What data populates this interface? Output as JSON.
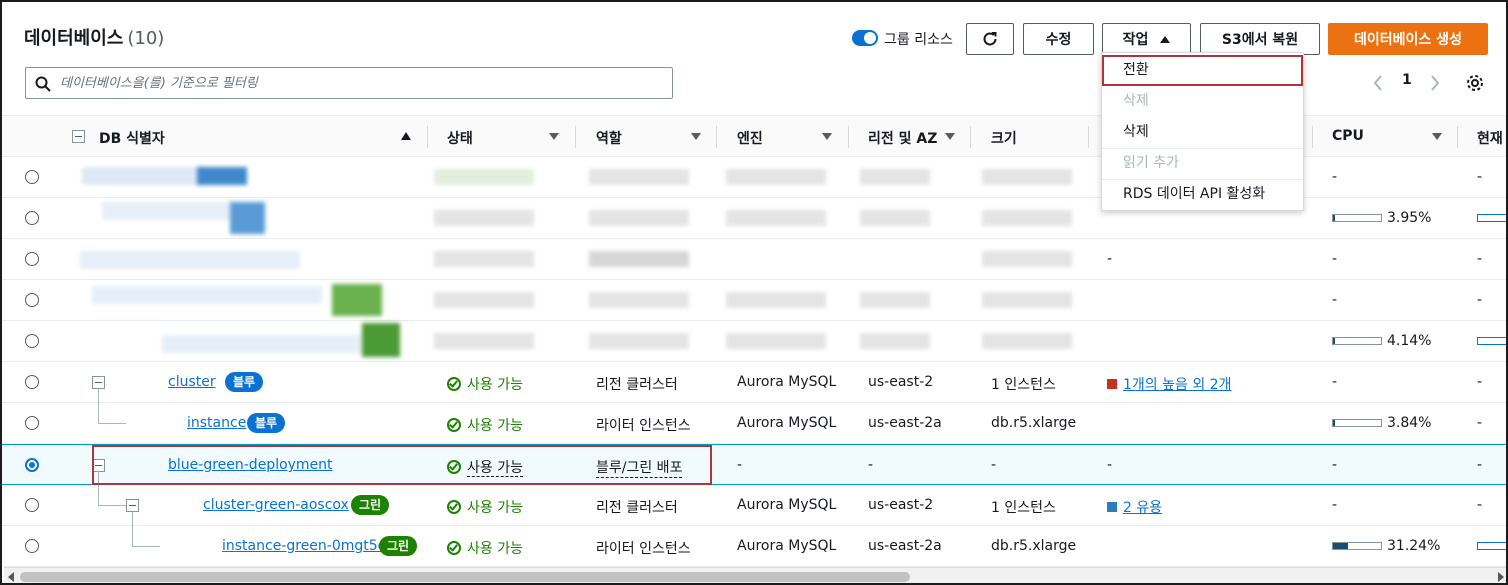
{
  "header": {
    "title": "데이터베이스",
    "count": "(10)",
    "group_toggle_label": "그룹 리소스",
    "modify_label": "수정",
    "actions_label": "작업",
    "restore_s3_label": "S3에서 복원",
    "create_db_label": "데이터베이스 생성"
  },
  "search": {
    "placeholder": "데이터베이스을(를) 기준으로 필터링"
  },
  "pager": {
    "page": "1"
  },
  "columns": {
    "db_id": "DB 식별자",
    "status": "상태",
    "role": "역할",
    "engine": "엔진",
    "region": "리전 및 AZ",
    "size": "크기",
    "cpu": "CPU",
    "current": "현재"
  },
  "actions_menu": {
    "items": [
      {
        "label": "전환",
        "disabled": false,
        "highlighted": true
      },
      {
        "label": "삭제",
        "disabled": true
      },
      {
        "label": "삭제",
        "disabled": false
      },
      {
        "label": "읽기 추가",
        "disabled": true
      },
      {
        "label": "RDS 데이터 API 활성화",
        "disabled": false
      }
    ]
  },
  "blurred_rows": {
    "r0": {
      "col8": "-",
      "col9": "-"
    },
    "r1": {
      "cpu": "3.95%",
      "cpu_value": 3.95
    },
    "r2": {
      "col7": "-",
      "col8": "-",
      "col9": "-"
    },
    "r3": {
      "col8": "-",
      "col9": "-"
    },
    "r4": {
      "cpu": "4.14%",
      "cpu_value": 4.14
    }
  },
  "rows": [
    {
      "id": "cluster",
      "badge": "블루",
      "status": "사용 가능",
      "role": "리전 클러스터",
      "engine": "Aurora MySQL",
      "region": "us-east-2",
      "size": "1 인스턴스",
      "activity": "1개의 높음 외 2개",
      "activity_color": "#c4321c",
      "cpu": "-",
      "current": "-"
    },
    {
      "id": "instance",
      "badge": "블루",
      "status": "사용 가능",
      "role": "라이터 인스턴스",
      "engine": "Aurora MySQL",
      "region": "us-east-2a",
      "size": "db.r5.xlarge",
      "activity": "",
      "cpu": "3.84%",
      "cpu_value": 3.84,
      "current": "-"
    },
    {
      "id": "blue-green-deployment",
      "status": "사용 가능",
      "role": "블루/그린 배포",
      "engine": "-",
      "region": "-",
      "size": "-",
      "activity": "-",
      "cpu": "-",
      "current": "-"
    },
    {
      "id": "cluster-green-aoscox",
      "badge": "그린",
      "status": "사용 가능",
      "role": "리전 클러스터",
      "engine": "Aurora MySQL",
      "region": "us-east-2",
      "size": "1 인스턴스",
      "activity": "2 유용",
      "activity_color": "#2e7bbf",
      "cpu": "-",
      "current": "-"
    },
    {
      "id": "instance-green-0mgt5e",
      "badge": "그린",
      "status": "사용 가능",
      "role": "라이터 인스턴스",
      "engine": "Aurora MySQL",
      "region": "us-east-2a",
      "size": "db.r5.xlarge",
      "activity": "",
      "cpu": "31.24%",
      "cpu_value": 31.24,
      "current": "-"
    }
  ]
}
